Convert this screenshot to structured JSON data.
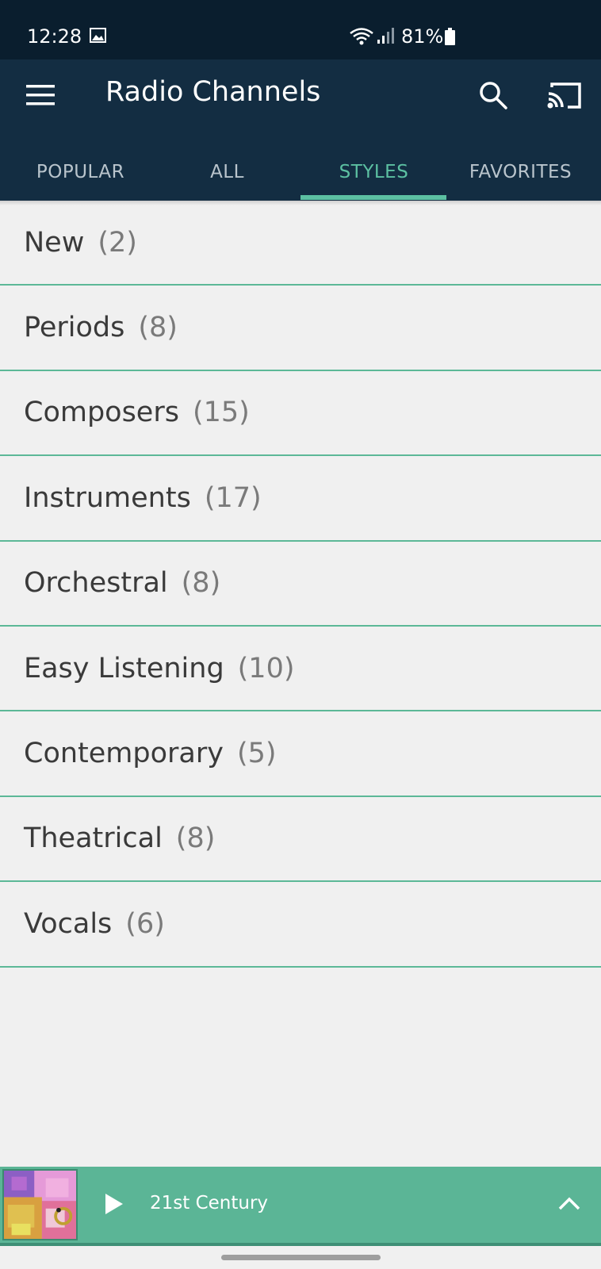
{
  "status_bar": {
    "time": "12:28",
    "battery": "81%",
    "icons": [
      "gallery-icon",
      "wifi-icon",
      "signal-icon",
      "battery-icon"
    ]
  },
  "app_bar": {
    "title": "Radio Channels",
    "icons": [
      "menu-icon",
      "search-icon",
      "cast-icon"
    ]
  },
  "tabs": [
    {
      "label": "POPULAR",
      "active": false
    },
    {
      "label": "ALL",
      "active": false
    },
    {
      "label": "STYLES",
      "active": true
    },
    {
      "label": "FAVORITES",
      "active": false
    }
  ],
  "styles": [
    {
      "label": "New",
      "count": "(2)"
    },
    {
      "label": "Periods",
      "count": "(8)"
    },
    {
      "label": "Composers",
      "count": "(15)"
    },
    {
      "label": "Instruments",
      "count": "(17)"
    },
    {
      "label": "Orchestral",
      "count": "(8)"
    },
    {
      "label": "Easy Listening",
      "count": "(10)"
    },
    {
      "label": "Contemporary",
      "count": "(5)"
    },
    {
      "label": "Theatrical",
      "count": "(8)"
    },
    {
      "label": "Vocals",
      "count": "(6)"
    }
  ],
  "player": {
    "title": "21st Century",
    "icons": [
      "play-icon",
      "chevron-up-icon"
    ]
  },
  "colors": {
    "status_bar": "#0a1e2e",
    "app_bar": "#132d42",
    "accent": "#5cc0a2",
    "player": "#5bb596",
    "background": "#f0f0f0"
  }
}
